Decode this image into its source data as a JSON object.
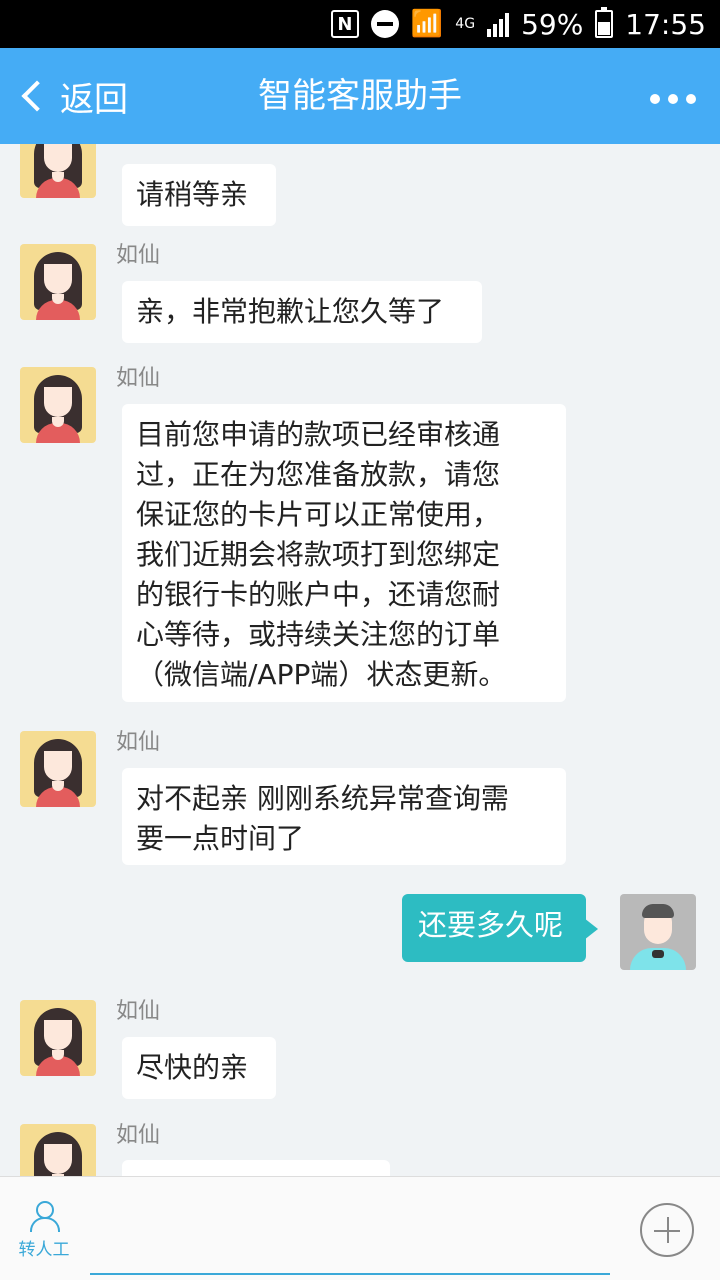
{
  "status_bar": {
    "battery": "59%",
    "time": "17:55",
    "network": "4G"
  },
  "header": {
    "back_label": "返回",
    "title": "智能客服助手"
  },
  "messages": [
    {
      "sender": "",
      "text": "请稍等亲",
      "from": "agent"
    },
    {
      "sender": "如仙",
      "text": "亲，非常抱歉让您久等了",
      "from": "agent"
    },
    {
      "sender": "如仙",
      "lines": [
        "目前您申请的款项已经审核通",
        "过，正在为您准备放款，请您",
        "保证您的卡片可以正常使用，",
        "我们近期会将款项打到您绑定",
        "的银行卡的账户中，还请您耐",
        "心等待，或持续关注您的订单",
        "（微信端/APP端）状态更新。"
      ],
      "from": "agent"
    },
    {
      "sender": "如仙",
      "lines": [
        "对不起亲 刚刚系统异常查询需",
        "要一点时间了"
      ],
      "from": "agent"
    },
    {
      "sender": "",
      "text": "还要多久呢",
      "from": "user"
    },
    {
      "sender": "如仙",
      "text": "尽快的亲",
      "from": "agent"
    },
    {
      "sender": "如仙",
      "text": "",
      "from": "agent"
    }
  ],
  "bottom_bar": {
    "transfer_label": "转人工"
  },
  "colors": {
    "header": "#45acf5",
    "user_bubble": "#2dbcc2"
  }
}
